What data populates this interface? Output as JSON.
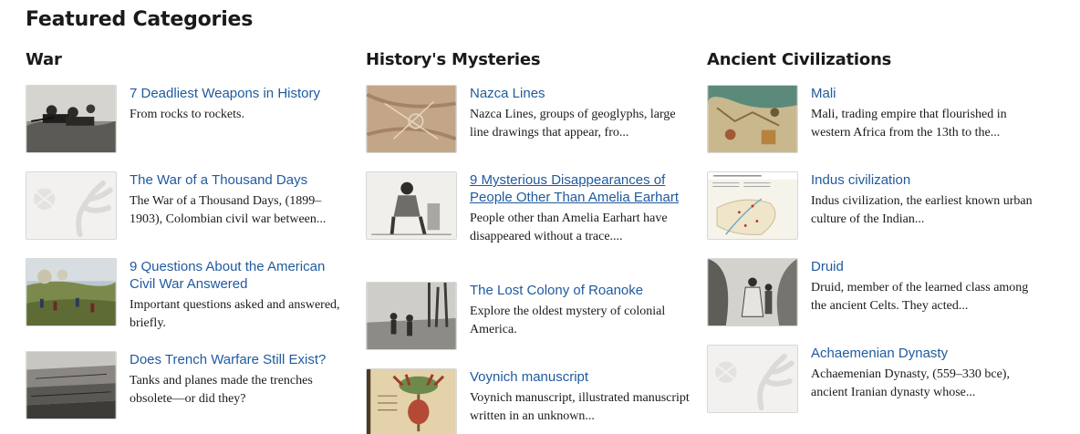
{
  "page": {
    "title": "Featured Categories"
  },
  "columns": [
    {
      "heading": "War",
      "items": [
        {
          "title": "7 Deadliest Weapons in History",
          "description": "From rocks to rockets.",
          "thumb_icon": "soldiers-machine-gun-photo"
        },
        {
          "title": "The War of a Thousand Days",
          "description": "The War of a Thousand Days, (1899–1903), Colombian civil war between...",
          "thumb_icon": "placeholder-thistle-logo"
        },
        {
          "title": "9 Questions About the American Civil War Answered",
          "description": "Important questions asked and answered, briefly.",
          "thumb_icon": "civil-war-battle-painting"
        },
        {
          "title": "Does Trench Warfare Still Exist?",
          "description": "Tanks and planes made the trenches obsolete—or did they?",
          "thumb_icon": "trench-photo"
        }
      ]
    },
    {
      "heading": "History's Mysteries",
      "items": [
        {
          "title": "Nazca Lines",
          "description": "Nazca Lines, groups of geoglyphs, large line drawings that appear, fro...",
          "thumb_icon": "nazca-lines-aerial-photo"
        },
        {
          "title": "9 Mysterious Disappearances of People Other Than Amelia Earhart",
          "description": "People other than Amelia Earhart have disappeared without a trace....",
          "thumb_icon": "seated-man-engraving"
        },
        {
          "title": "The Lost Colony of Roanoke",
          "description": "Explore the oldest mystery of colonial America.",
          "thumb_icon": "roanoke-engraving"
        },
        {
          "title": "Voynich manuscript",
          "description": "Voynich manuscript, illustrated manuscript written in an unknown...",
          "thumb_icon": "voynich-page-photo"
        }
      ]
    },
    {
      "heading": "Ancient Civilizations",
      "items": [
        {
          "title": "Mali",
          "description": "Mali, trading empire that flourished in western Africa from the 13th to the...",
          "thumb_icon": "catalan-atlas-map"
        },
        {
          "title": "Indus civilization",
          "description": "Indus civilization, the earliest known urban culture of the Indian...",
          "thumb_icon": "indus-sites-map"
        },
        {
          "title": "Druid",
          "description": "Druid, member of the learned class among the ancient Celts. They acted...",
          "thumb_icon": "druids-engraving"
        },
        {
          "title": "Achaemenian Dynasty",
          "description": "Achaemenian Dynasty, (559–330 bce), ancient Iranian dynasty whose...",
          "thumb_icon": "placeholder-thistle-logo"
        }
      ]
    }
  ],
  "colors": {
    "link": "#1f5a9e",
    "text": "#1a1a1a",
    "thumb_border": "#d8d8d8"
  }
}
